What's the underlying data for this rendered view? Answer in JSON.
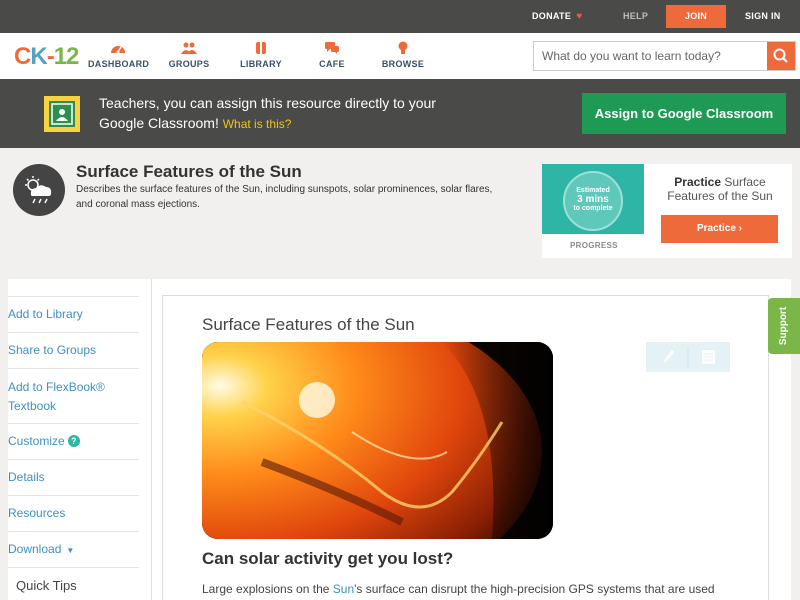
{
  "topbar": {
    "donate": "DONATE",
    "help": "HELP",
    "join": "JOIN",
    "signin": "SIGN IN"
  },
  "nav": {
    "logo": {
      "c": "C",
      "k": "K",
      "dash": "-",
      "num": "12"
    },
    "items": [
      {
        "label": "DASHBOARD",
        "icon": "dashboard-icon"
      },
      {
        "label": "GROUPS",
        "icon": "groups-icon"
      },
      {
        "label": "LIBRARY",
        "icon": "library-icon"
      },
      {
        "label": "CAFE",
        "icon": "cafe-icon"
      },
      {
        "label": "BROWSE",
        "icon": "browse-icon"
      }
    ],
    "search_placeholder": "What do you want to learn today?"
  },
  "banner": {
    "text": "Teachers, you can assign this resource directly to your Google Classroom!",
    "what": "What is this?",
    "assign": "Assign to Google Classroom"
  },
  "header": {
    "title": "Surface Features of the Sun",
    "description": "Describes the surface features of the Sun, including sunspots, solar prominences, solar flares, and coronal mass ejections."
  },
  "practice": {
    "estimated": "Estimated",
    "mins": "3 mins",
    "complete": "to complete",
    "progress": "PROGRESS",
    "title_bold": "Practice",
    "title_rest": " Surface Features of the Sun",
    "button": "Practice"
  },
  "sidebar": {
    "items": [
      {
        "label": "Add to Library"
      },
      {
        "label": "Share to Groups"
      },
      {
        "label": "Add to FlexBook® Textbook"
      },
      {
        "label": "Customize"
      },
      {
        "label": "Details"
      },
      {
        "label": "Resources"
      },
      {
        "label": "Download"
      }
    ],
    "quick_tips": "Quick Tips"
  },
  "content": {
    "title": "Surface Features of the Sun",
    "subheading": "Can solar activity get you lost?",
    "body_pre": "Large explosions on the ",
    "body_link": "Sun",
    "body_post": "'s surface can disrupt the high-precision GPS systems that are used"
  },
  "support": "Support",
  "colors": {
    "accent": "#ee6a3b",
    "link": "#3e8fc3",
    "google_green": "#1e9a55",
    "support_green": "#7ab648",
    "teal": "#2eb5a6"
  }
}
